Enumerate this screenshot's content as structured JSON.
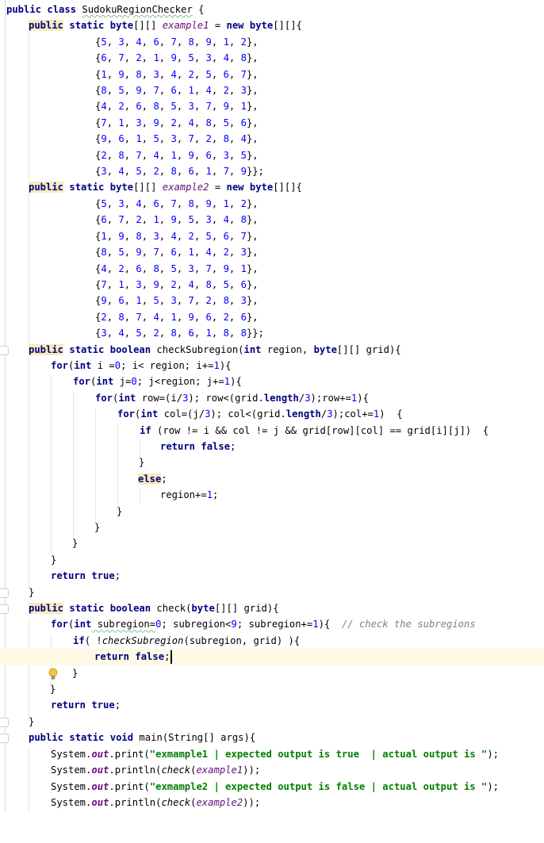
{
  "editor": {
    "language": "Java",
    "class_decl": {
      "kw1": "public",
      "kw2": "class",
      "name": "SudokuRegionChecker",
      "brace": " {"
    },
    "example1": {
      "decl": {
        "public": "public",
        "static": " static ",
        "type": "byte",
        "brackets": "[][] ",
        "name": "example1",
        "eq": " = ",
        "new": "new",
        "type2": " byte",
        "tail": "[][]{"
      },
      "rows": [
        "{5, 3, 4, 6, 7, 8, 9, 1, 2},",
        "{6, 7, 2, 1, 9, 5, 3, 4, 8},",
        "{1, 9, 8, 3, 4, 2, 5, 6, 7},",
        "{8, 5, 9, 7, 6, 1, 4, 2, 3},",
        "{4, 2, 6, 8, 5, 3, 7, 9, 1},",
        "{7, 1, 3, 9, 2, 4, 8, 5, 6},",
        "{9, 6, 1, 5, 3, 7, 2, 8, 4},",
        "{2, 8, 7, 4, 1, 9, 6, 3, 5},",
        "{3, 4, 5, 2, 8, 6, 1, 7, 9}};"
      ]
    },
    "example2": {
      "decl": {
        "public": "public",
        "static": " static ",
        "type": "byte",
        "brackets": "[][] ",
        "name": "example2",
        "eq": " = ",
        "new": "new",
        "type2": " byte",
        "tail": "[][]{"
      },
      "rows": [
        "{5, 3, 4, 6, 7, 8, 9, 1, 2},",
        "{6, 7, 2, 1, 9, 5, 3, 4, 8},",
        "{1, 9, 8, 3, 4, 2, 5, 6, 7},",
        "{8, 5, 9, 7, 6, 1, 4, 2, 3},",
        "{4, 2, 6, 8, 5, 3, 7, 9, 1},",
        "{7, 1, 3, 9, 2, 4, 8, 5, 6},",
        "{9, 6, 1, 5, 3, 7, 2, 8, 3},",
        "{2, 8, 7, 4, 1, 9, 6, 2, 6},",
        "{3, 4, 5, 2, 8, 6, 1, 8, 8}};"
      ]
    },
    "lines": {
      "cs_sig": [
        "public",
        " static boolean",
        " checkSubregion(",
        "int",
        " region, ",
        "byte",
        "[][] grid){"
      ],
      "for_i": [
        "for",
        "(",
        "int",
        " i =",
        "0",
        "; i< region; i+=",
        "1",
        "){"
      ],
      "for_j": [
        "for",
        "(",
        "int",
        " j=",
        "0",
        "; j<region; j+=",
        "1",
        "){"
      ],
      "for_row": [
        "for",
        "(",
        "int",
        " row=(i/",
        "3",
        "); row<(grid.",
        "length",
        "/",
        "3",
        ");row+=",
        "1",
        "){"
      ],
      "for_col": [
        "for",
        "(",
        "int",
        " col=(j/",
        "3",
        "); col<(grid.",
        "length",
        "/",
        "3",
        ");col+=",
        "1",
        ")  {"
      ],
      "if_cmp": [
        "if",
        " (row != i && col != j && grid[row][col] == grid[i][j])  {"
      ],
      "return_false": [
        "return false",
        ";"
      ],
      "close": "}",
      "else": [
        "else",
        ";"
      ],
      "region_inc": [
        "region+=",
        "1",
        ";"
      ],
      "return_true": [
        "return true",
        ";"
      ],
      "check_sig": [
        "public",
        " static boolean",
        " check(",
        "byte",
        "[][] grid){"
      ],
      "for_sub": [
        "for",
        "(",
        "int",
        " subregion=",
        "0",
        "; subregion<",
        "9",
        "; subregion+=",
        "1",
        "){  ",
        "// check the subregions"
      ],
      "if_not": [
        "if",
        "( !",
        "checkSubregion",
        "(subregion, grid) ){"
      ],
      "main_sig": [
        "public",
        " static void",
        " main(String[] args){"
      ],
      "print1": [
        "System.",
        "out",
        ".print(",
        "\"exmample1 | expected output is true  | actual output is \"",
        ");"
      ],
      "println1": [
        "System.",
        "out",
        ".println(",
        "check",
        "(",
        "example1",
        "));"
      ],
      "print2": [
        "System.",
        "out",
        ".print(",
        "\"exmample2 | expected output is false | actual output is \"",
        ");"
      ],
      "println2": [
        "System.",
        "out",
        ".println(",
        "check",
        "(",
        "example2",
        "));"
      ]
    },
    "gutter": {
      "intention_icon": "lightbulb-icon",
      "fold_icon": "fold-marker-icon"
    }
  }
}
